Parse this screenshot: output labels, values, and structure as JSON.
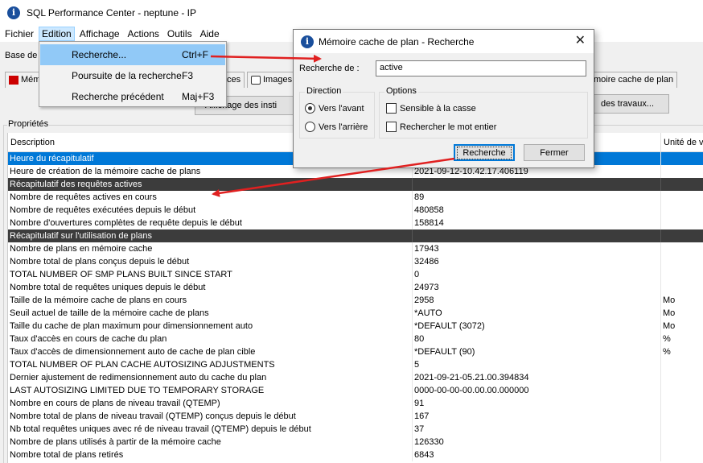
{
  "window": {
    "title": "SQL Performance Center - neptune - IP",
    "icon": "app-info-icon"
  },
  "menubar": [
    "Fichier",
    "Edition",
    "Affichage",
    "Actions",
    "Outils",
    "Aide"
  ],
  "base_label": "Base de",
  "tabs": {
    "t1": "Mémo",
    "t2": "ces",
    "t3": "Images",
    "t4": "moire cache de plan"
  },
  "buttons": {
    "affichage": "Affichage des insti",
    "travaux": "des travaux..."
  },
  "edit_menu": [
    {
      "label": "Recherche...",
      "shortcut": "Ctrl+F"
    },
    {
      "label": "Poursuite de la recherche",
      "shortcut": "F3"
    },
    {
      "label": "Recherche précédent",
      "shortcut": "Maj+F3"
    }
  ],
  "dialog": {
    "title": "Mémoire cache de plan - Recherche",
    "search_label": "Recherche de :",
    "search_value": "active",
    "direction": {
      "title": "Direction",
      "forward": "Vers l'avant",
      "backward": "Vers l'arrière",
      "selected": "forward"
    },
    "options": {
      "title": "Options",
      "case": "Sensible à la casse",
      "word": "Rechercher le mot entier"
    },
    "search_button": "Recherche",
    "close_button": "Fermer"
  },
  "properties": {
    "label": "Propriétés",
    "columns": [
      "Description",
      "",
      "Unité de v"
    ],
    "rows": [
      {
        "type": "selected",
        "desc": "Heure du récapitulatif",
        "val": "",
        "unit": ""
      },
      {
        "type": "data",
        "desc": "Heure de création de la mémoire cache de plans",
        "val": "2021-09-12-10.42.17.406119",
        "unit": ""
      },
      {
        "type": "section",
        "desc": "Récapitulatif des requêtes actives",
        "val": "",
        "unit": ""
      },
      {
        "type": "data",
        "desc": "Nombre de requêtes actives en cours",
        "val": "89",
        "unit": ""
      },
      {
        "type": "data",
        "desc": "Nombre de requêtes exécutées depuis le début",
        "val": "480858",
        "unit": ""
      },
      {
        "type": "data",
        "desc": "Nombre d'ouvertures complètes de requête depuis le début",
        "val": "158814",
        "unit": ""
      },
      {
        "type": "section",
        "desc": "Récapitulatif sur l'utilisation de plans",
        "val": "",
        "unit": ""
      },
      {
        "type": "data",
        "desc": "Nombre de plans en mémoire cache",
        "val": "17943",
        "unit": ""
      },
      {
        "type": "data",
        "desc": "Nombre total de plans conçus depuis le début",
        "val": "32486",
        "unit": ""
      },
      {
        "type": "data",
        "desc": "TOTAL NUMBER OF SMP PLANS BUILT SINCE START",
        "val": "0",
        "unit": ""
      },
      {
        "type": "data",
        "desc": "Nombre total de requêtes uniques depuis le début",
        "val": "24973",
        "unit": ""
      },
      {
        "type": "data",
        "desc": "Taille de la mémoire cache de plans en cours",
        "val": "2958",
        "unit": "Mo"
      },
      {
        "type": "data",
        "desc": "Seuil actuel de taille de la mémoire cache de plans",
        "val": "*AUTO",
        "unit": "Mo"
      },
      {
        "type": "data",
        "desc": "Taille du cache de plan maximum pour dimensionnement auto",
        "val": "*DEFAULT (3072)",
        "unit": "Mo"
      },
      {
        "type": "data",
        "desc": "Taux d'accès en cours de cache du plan",
        "val": "80",
        "unit": "%"
      },
      {
        "type": "data",
        "desc": "Taux d'accès de dimensionnement auto de cache de plan cible",
        "val": "*DEFAULT (90)",
        "unit": "%"
      },
      {
        "type": "data",
        "desc": "TOTAL NUMBER OF PLAN CACHE AUTOSIZING ADJUSTMENTS",
        "val": "5",
        "unit": ""
      },
      {
        "type": "data",
        "desc": "Dernier ajustement de redimensionnement auto du cache du plan",
        "val": "2021-09-21-05.21.00.394834",
        "unit": ""
      },
      {
        "type": "data",
        "desc": "LAST AUTOSIZING LIMITED DUE TO TEMPORARY STORAGE",
        "val": "0000-00-00-00.00.00.000000",
        "unit": ""
      },
      {
        "type": "data",
        "desc": "Nombre en cours de plans de niveau travail (QTEMP)",
        "val": "91",
        "unit": ""
      },
      {
        "type": "data",
        "desc": "Nombre total de plans de niveau travail (QTEMP) conçus depuis le début",
        "val": "167",
        "unit": ""
      },
      {
        "type": "data",
        "desc": "Nb total requêtes uniques avec ré de niveau travail (QTEMP) depuis le début",
        "val": "37",
        "unit": ""
      },
      {
        "type": "data",
        "desc": "Nombre de plans utilisés à partir de la mémoire cache",
        "val": "126330",
        "unit": ""
      },
      {
        "type": "data",
        "desc": "Nombre total de plans retirés",
        "val": "6843",
        "unit": ""
      }
    ]
  },
  "colors": {
    "selection": "#0078d7",
    "section": "#3c3c3c",
    "arrow": "#e02020",
    "menu_hover": "#91c9f7"
  }
}
